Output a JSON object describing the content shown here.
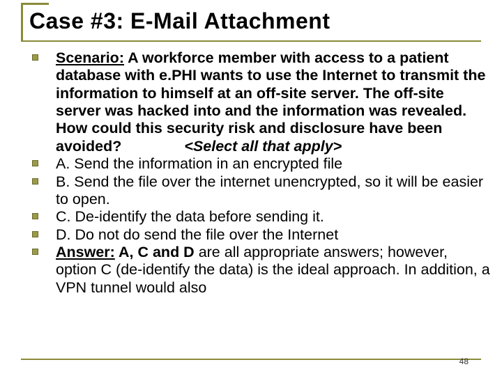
{
  "title": "Case #3:  E-Mail Attachment",
  "pageNumber": "48",
  "items": {
    "scenario": {
      "lead": "Scenario:",
      "body": "  A workforce member with access to a patient database with e.PHI wants to use the Internet to transmit the information to himself at an off-site server.  The off-site server was hacked into and the information was revealed.  How could this security risk and disclosure have been avoided?",
      "hint": "<Select all that apply>"
    },
    "a": "A.  Send the information in an encrypted file",
    "b": "B.  Send the file over the internet unencrypted, so it will be easier to open.",
    "c": "C.  De-identify the data before sending it.",
    "d": "D.  Do not do send the file over the Internet",
    "answer": {
      "lead": "Answer:",
      "bold": "  A, C and D ",
      "rest": "are all appropriate answers; however, option C (de-identify the data) is the ideal approach.  In addition, a VPN tunnel would also"
    }
  }
}
